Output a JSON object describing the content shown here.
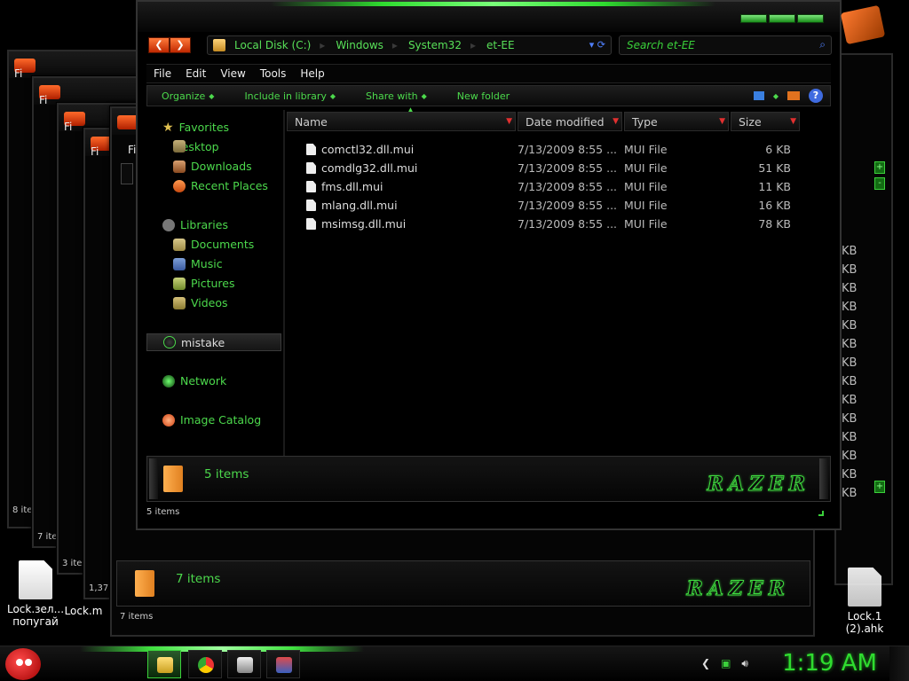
{
  "main_window": {
    "breadcrumb": [
      "Local Disk (C:)",
      "Windows",
      "System32",
      "et-EE"
    ],
    "search_placeholder": "Search et-EE",
    "menu": [
      "File",
      "Edit",
      "View",
      "Tools",
      "Help"
    ],
    "toolbar": [
      "Organize",
      "Include in library",
      "Share with",
      "New folder"
    ],
    "nav": {
      "favorites": "Favorites",
      "favorites_items": [
        "Desktop",
        "Downloads",
        "Recent Places"
      ],
      "libraries": "Libraries",
      "libraries_items": [
        "Documents",
        "Music",
        "Pictures",
        "Videos"
      ],
      "homegroup": "mistake",
      "network": "Network",
      "catalog": "Image Catalog"
    },
    "columns": [
      "Name",
      "Date modified",
      "Type",
      "Size"
    ],
    "files": [
      {
        "name": "comctl32.dll.mui",
        "date": "7/13/2009 8:55 ...",
        "type": "MUI File",
        "size": "6 KB"
      },
      {
        "name": "comdlg32.dll.mui",
        "date": "7/13/2009 8:55 ...",
        "type": "MUI File",
        "size": "51 KB"
      },
      {
        "name": "fms.dll.mui",
        "date": "7/13/2009 8:55 ...",
        "type": "MUI File",
        "size": "11 KB"
      },
      {
        "name": "mlang.dll.mui",
        "date": "7/13/2009 8:55 ...",
        "type": "MUI File",
        "size": "16 KB"
      },
      {
        "name": "msimsg.dll.mui",
        "date": "7/13/2009 8:55 ...",
        "type": "MUI File",
        "size": "78 KB"
      }
    ],
    "details_count": "5 items",
    "status_count": "5 items",
    "logo": "RAZER"
  },
  "second_window": {
    "details_count": "7 items",
    "status_count": "7 items"
  },
  "background_windows": {
    "menu_fragment": "Fi",
    "status_fragments": [
      "8 ite",
      "7 ite",
      "3 ite",
      "1,37"
    ]
  },
  "right_window_sizes": [
    "KB",
    "KB",
    "KB",
    "KB",
    "KB",
    "KB",
    "KB",
    "KB",
    "KB",
    "KB",
    "KB",
    "KB",
    "KB",
    "KB"
  ],
  "desktop_icons": [
    {
      "label": "Lock.зел... попугай"
    },
    {
      "label": "Lock.m"
    },
    {
      "label": "Lock.1 (2).ahk"
    }
  ],
  "taskbar": {
    "clock": "1:19 AM"
  },
  "colors": {
    "accent": "#3bd13b",
    "nav_orange": "#e0501a",
    "bg": "#000000"
  }
}
